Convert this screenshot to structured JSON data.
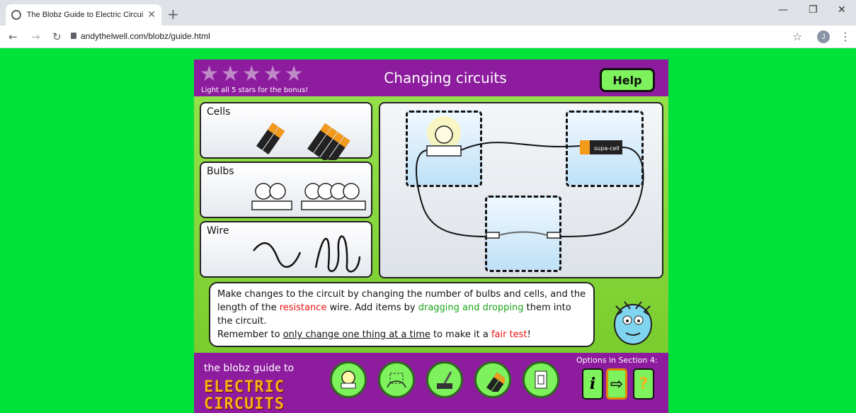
{
  "browser": {
    "tab_title": "The Blobz Guide to Electric Circui",
    "url": "andythelwell.com/blobz/guide.html",
    "avatar_letter": "J"
  },
  "header": {
    "title": "Changing circuits",
    "bonus_text": "Light all 5 stars for the bonus!",
    "help_label": "Help",
    "stars_total": 5,
    "stars_lit": 0
  },
  "components": {
    "cells_label": "Cells",
    "bulbs_label": "Bulbs",
    "wire_label": "Wire"
  },
  "circuit": {
    "cell_label": "supa-cell"
  },
  "instructions": {
    "p1_a": "Make changes to the circuit by changing the number of bulbs and cells, and the length of the ",
    "p1_resistance": "resistance",
    "p1_b": " wire. Add items by ",
    "p1_drag": "dragging and dropping",
    "p1_c": " them into the circuit.",
    "p2_a": "Remember to ",
    "p2_ul": "only change one thing at a time",
    "p2_b": " to make it a ",
    "p2_fair": "fair test",
    "p2_c": "!"
  },
  "footer": {
    "guide_text": "the blobz guide to",
    "logo_line1": "ELECTRIC",
    "logo_line2": "CIRCUITS",
    "options_label": "Options in Section 4:",
    "info_label": "i",
    "help_label": "?"
  },
  "colors": {
    "page_bg": "#00e23a",
    "frame": "#8d1c9e",
    "accent_green": "#7df25c"
  }
}
